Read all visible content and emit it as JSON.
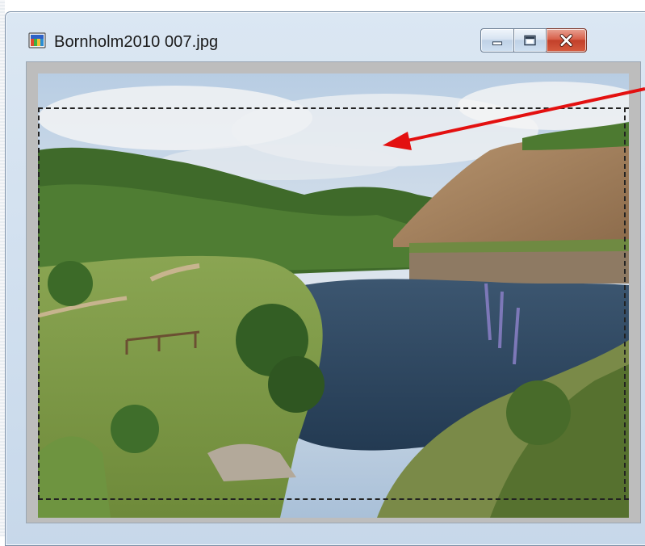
{
  "window": {
    "title": "Bornholm2010 007.jpg",
    "title_icon": "image-file-icon"
  },
  "controls": {
    "minimize_icon": "minimize-icon",
    "maximize_icon": "maximize-icon",
    "close_icon": "close-icon"
  },
  "image": {
    "subject": "quarry-lake-landscape",
    "selection": "dashed-crop-marquee"
  },
  "annotation": {
    "arrow_color": "#e31010",
    "arrow_icon": "red-arrow-icon"
  },
  "colors": {
    "titlebar": "#cfdeee",
    "close_button": "#d55a3e",
    "client_bg": "#bdbdbd"
  }
}
